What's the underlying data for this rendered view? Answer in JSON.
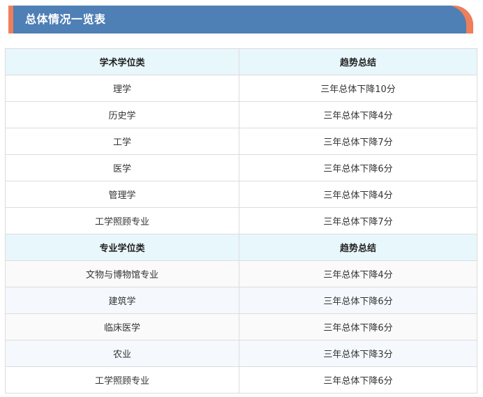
{
  "title": "总体情况一览表",
  "sections": [
    {
      "header": {
        "category": "学术学位类",
        "trend": "趋势总结"
      },
      "rows": [
        {
          "category": "理学",
          "trend": "三年总体下降10分"
        },
        {
          "category": "历史学",
          "trend": "三年总体下降4分"
        },
        {
          "category": "工学",
          "trend": "三年总体下降7分"
        },
        {
          "category": "医学",
          "trend": "三年总体下降6分"
        },
        {
          "category": "管理学",
          "trend": "三年总体下降4分"
        },
        {
          "category": "工学照顾专业",
          "trend": "三年总体下降7分"
        }
      ]
    },
    {
      "header": {
        "category": "专业学位类",
        "trend": "趋势总结"
      },
      "rows": [
        {
          "category": "文物与博物馆专业",
          "trend": "三年总体下降4分"
        },
        {
          "category": "建筑学",
          "trend": "三年总体下降6分"
        },
        {
          "category": "临床医学",
          "trend": "三年总体下降6分"
        },
        {
          "category": "农业",
          "trend": "三年总体下降3分"
        },
        {
          "category": "工学照顾专业",
          "trend": "三年总体下降6分"
        }
      ]
    }
  ],
  "colors": {
    "title_bg": "#4e7fb5",
    "title_accent": "#f07e5a",
    "header_bg": "#e8f7fb",
    "border": "#dcdcdc"
  }
}
